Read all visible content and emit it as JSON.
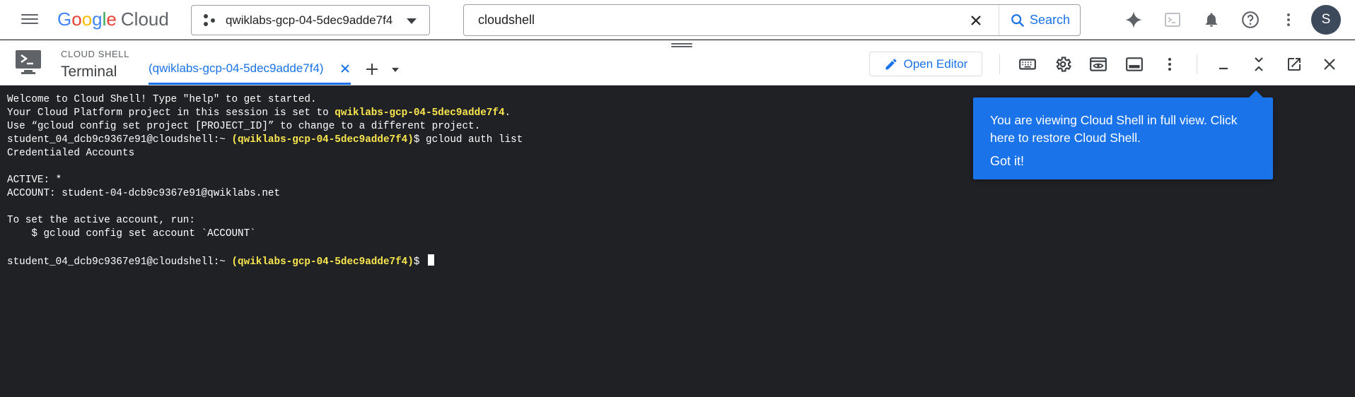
{
  "app": {
    "logo": {
      "letters": [
        "G",
        "o",
        "o",
        "g",
        "l",
        "e"
      ],
      "product": "Cloud"
    },
    "project_picker": {
      "label": "qwiklabs-gcp-04-5dec9adde7f4"
    },
    "search": {
      "value": "cloudshell",
      "button_label": "Search"
    },
    "avatar_initial": "S"
  },
  "shell": {
    "section_label": "CLOUD SHELL",
    "title": "Terminal",
    "tab": {
      "label": "(qwiklabs-gcp-04-5dec9adde7f4)"
    },
    "open_editor_label": "Open Editor"
  },
  "terminal": {
    "lines": [
      {
        "segments": [
          {
            "text": "Welcome to Cloud Shell! Type \"help\" to get started.",
            "hl": false
          }
        ]
      },
      {
        "segments": [
          {
            "text": "Your Cloud Platform project in this session is set to ",
            "hl": false
          },
          {
            "text": "qwiklabs-gcp-04-5dec9adde7f4",
            "hl": true
          },
          {
            "text": ".",
            "hl": false
          }
        ]
      },
      {
        "segments": [
          {
            "text": "Use “gcloud config set project [PROJECT_ID]” to change to a different project.",
            "hl": false
          }
        ]
      },
      {
        "segments": [
          {
            "text": "student_04_dcb9c9367e91@cloudshell:~ ",
            "hl": false
          },
          {
            "text": "(qwiklabs-gcp-04-5dec9adde7f4)",
            "hl": true
          },
          {
            "text": "$ gcloud auth list",
            "hl": false
          }
        ]
      },
      {
        "segments": [
          {
            "text": "Credentialed Accounts",
            "hl": false
          }
        ]
      },
      {
        "segments": [
          {
            "text": "",
            "hl": false
          }
        ]
      },
      {
        "segments": [
          {
            "text": "ACTIVE: *",
            "hl": false
          }
        ]
      },
      {
        "segments": [
          {
            "text": "ACCOUNT: student-04-dcb9c9367e91@qwiklabs.net",
            "hl": false
          }
        ]
      },
      {
        "segments": [
          {
            "text": "",
            "hl": false
          }
        ]
      },
      {
        "segments": [
          {
            "text": "To set the active account, run:",
            "hl": false
          }
        ]
      },
      {
        "segments": [
          {
            "text": "    $ gcloud config set account `ACCOUNT`",
            "hl": false
          }
        ]
      },
      {
        "segments": [
          {
            "text": "",
            "hl": false
          }
        ]
      },
      {
        "segments": [
          {
            "text": "student_04_dcb9c9367e91@cloudshell:~ ",
            "hl": false
          },
          {
            "text": "(qwiklabs-gcp-04-5dec9adde7f4)",
            "hl": true
          },
          {
            "text": "$ ",
            "hl": false
          }
        ],
        "cursor": true
      }
    ]
  },
  "tooltip": {
    "text": "You are viewing Cloud Shell in full view. Click here to restore Cloud Shell.",
    "action_label": "Got it!"
  },
  "colors": {
    "accent": "#1a73e8",
    "terminal_bg": "#202124",
    "terminal_highlight": "#f9e64f"
  }
}
